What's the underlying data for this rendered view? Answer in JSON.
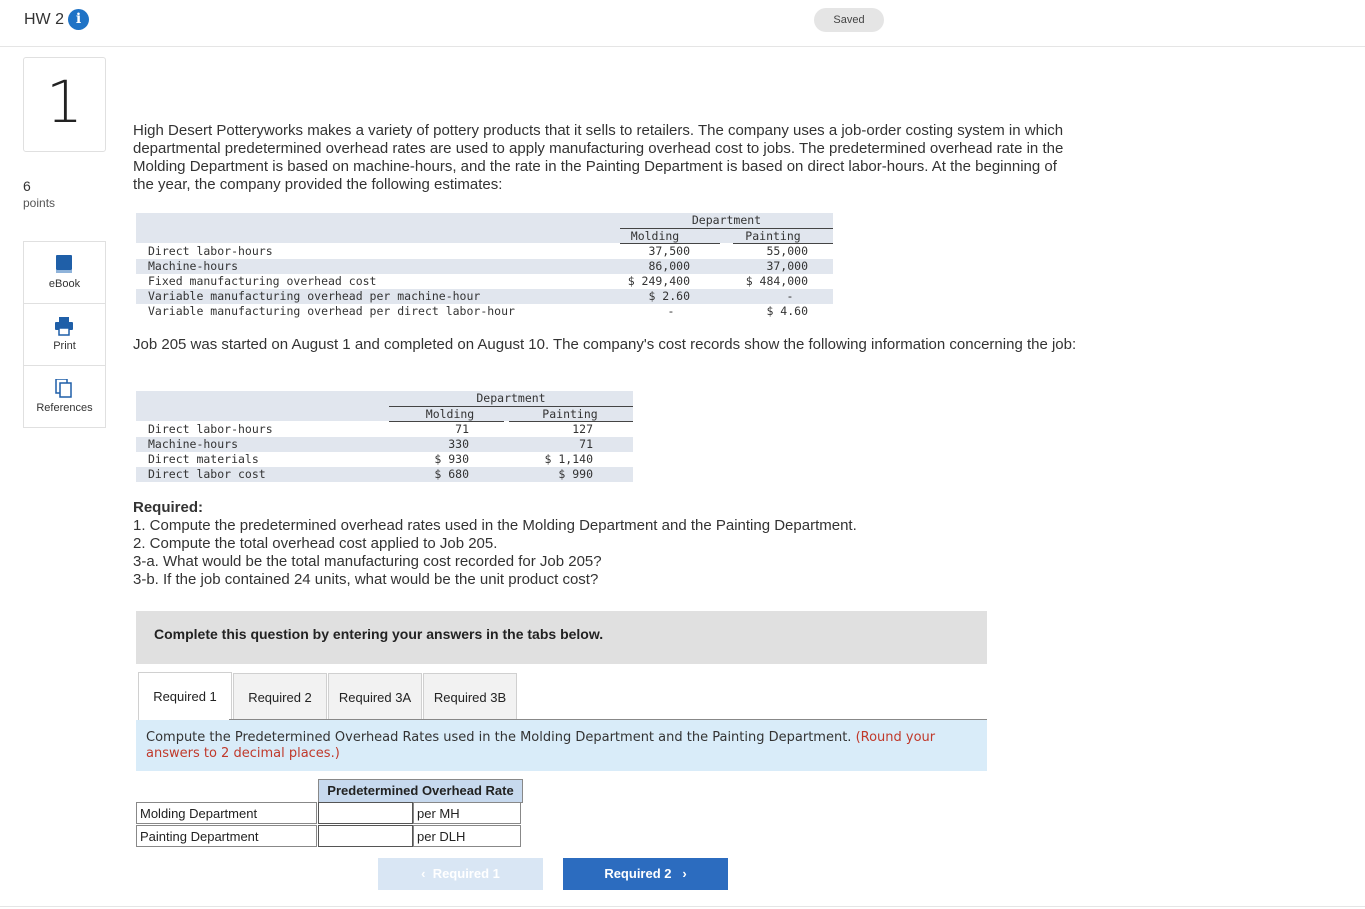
{
  "header": {
    "title": "HW 2",
    "saved": "Saved"
  },
  "question": {
    "number": "1",
    "points": "6",
    "points_label": "points"
  },
  "tools": [
    {
      "icon": "ebook-icon",
      "label": "eBook"
    },
    {
      "icon": "print-icon",
      "label": "Print"
    },
    {
      "icon": "references-icon",
      "label": "References"
    }
  ],
  "intro": "High Desert Potteryworks makes a variety of pottery products that it sells to retailers. The company uses a job-order costing system in which departmental predetermined overhead rates are used to apply manufacturing overhead cost to jobs. The predetermined overhead rate in the Molding Department is based on machine-hours, and the rate in the Painting Department is based on direct labor-hours. At the beginning of the year, the company provided the following estimates:",
  "table1": {
    "group": "Department",
    "cols": [
      "Molding",
      "Painting"
    ],
    "rows": [
      {
        "label": "Direct labor-hours",
        "molding": "37,500",
        "painting": "55,000"
      },
      {
        "label": "Machine-hours",
        "molding": "86,000",
        "painting": "37,000"
      },
      {
        "label": "Fixed manufacturing overhead cost",
        "molding": "$ 249,400",
        "painting": "$ 484,000"
      },
      {
        "label": "Variable manufacturing overhead per machine-hour",
        "molding": "$ 2.60",
        "painting": "-"
      },
      {
        "label": "Variable manufacturing overhead per direct labor-hour",
        "molding": "-",
        "painting": "$ 4.60"
      }
    ]
  },
  "job_text": "Job 205 was started on August 1 and completed on August 10. The company's cost records show the following information concerning the job:",
  "table2": {
    "group": "Department",
    "cols": [
      "Molding",
      "Painting"
    ],
    "rows": [
      {
        "label": "Direct labor-hours",
        "molding": "71",
        "painting": "127"
      },
      {
        "label": "Machine-hours",
        "molding": "330",
        "painting": "71"
      },
      {
        "label": "Direct materials",
        "molding": "$ 930",
        "painting": "$ 1,140"
      },
      {
        "label": "Direct labor cost",
        "molding": "$ 680",
        "painting": "$ 990"
      }
    ]
  },
  "required": {
    "heading": "Required:",
    "items": [
      "1. Compute the predetermined overhead rates used in the Molding Department and the Painting Department.",
      "2. Compute the total overhead cost applied to Job 205.",
      "3-a. What would be the total manufacturing cost recorded for Job 205?",
      "3-b. If the job contained 24 units, what would be the unit product cost?"
    ]
  },
  "complete_prompt": "Complete this question by entering your answers in the tabs below.",
  "tabs": [
    "Required 1",
    "Required 2",
    "Required 3A",
    "Required 3B"
  ],
  "instruction": {
    "main": "Compute the Predetermined Overhead Rates used in the Molding Department and the Painting Department.",
    "note": "(Round your answers to 2 decimal places.)"
  },
  "answer_grid": {
    "header": "Predetermined Overhead Rate",
    "rows": [
      {
        "label": "Molding Department",
        "value": "",
        "unit": "per MH"
      },
      {
        "label": "Painting Department",
        "value": "",
        "unit": "per DLH"
      }
    ]
  },
  "nav": {
    "prev": "Required 1",
    "next": "Required 2"
  },
  "colors": {
    "accent": "#2c6cbf",
    "info_blue": "#1f73c6",
    "table_band": "#e1e6ee",
    "instr_bg": "#d9ecf9",
    "note_red": "#c0392b"
  }
}
